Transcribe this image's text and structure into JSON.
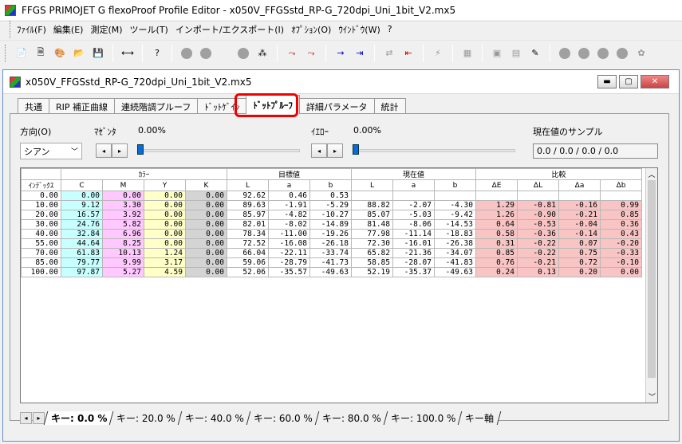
{
  "app": {
    "title": "FFGS PRIMOJET G flexoProof Profile Editor - x050V_FFGSstd_RP-G_720dpi_Uni_1bit_V2.mx5"
  },
  "menu": [
    "ﾌｧｲﾙ(F)",
    "編集(E)",
    "測定(M)",
    "ツール(T)",
    "インポート/エクスポート(I)",
    "ｵﾌﾟｼｮﾝ(O)",
    "ｳｲﾝﾄﾞｳ(W)",
    "?"
  ],
  "child": {
    "title": "x050V_FFGSstd_RP-G_720dpi_Uni_1bit_V2.mx5"
  },
  "tabs": [
    "共通",
    "RIP 補正曲線",
    "連続階調プルーフ",
    "ﾄﾞｯﾄｹﾞｲﾝ",
    "ﾄﾞｯﾄﾌﾟﾙｰﾌ",
    "詳細パラメータ",
    "統計"
  ],
  "active_tab": 4,
  "controls": {
    "direction_label": "方向(O)",
    "direction_value": "シアン",
    "magenta_label": "ﾏｾﾞﾝﾀ",
    "magenta_value": "0.00%",
    "yellow_label": "ｲｴﾛｰ",
    "yellow_value": "0.00%",
    "sample_label": "現在値のサンプル",
    "sample_value": "0.0 / 0.0 / 0.0 / 0.0"
  },
  "table": {
    "groups": {
      "color": "ｶﾗｰ",
      "target": "目標値",
      "current": "現在値",
      "compare": "比較"
    },
    "headers": [
      "ｲﾝﾃﾞｯｸｽ",
      "C",
      "M",
      "Y",
      "K",
      "L",
      "a",
      "b",
      "L",
      "a",
      "b",
      "ΔE",
      "ΔL",
      "Δa",
      "Δb"
    ],
    "rows": [
      [
        "0.00",
        "0.00",
        "0.00",
        "0.00",
        "0.00",
        "92.62",
        "0.46",
        "0.53",
        "",
        "",
        "",
        "",
        "",
        "",
        ""
      ],
      [
        "10.00",
        "9.12",
        "3.30",
        "0.00",
        "0.00",
        "89.63",
        "-1.91",
        "-5.29",
        "88.82",
        "-2.07",
        "-4.30",
        "1.29",
        "-0.81",
        "-0.16",
        "0.99"
      ],
      [
        "20.00",
        "16.57",
        "3.92",
        "0.00",
        "0.00",
        "85.97",
        "-4.82",
        "-10.27",
        "85.07",
        "-5.03",
        "-9.42",
        "1.26",
        "-0.90",
        "-0.21",
        "0.85"
      ],
      [
        "30.00",
        "24.76",
        "5.82",
        "0.00",
        "0.00",
        "82.01",
        "-8.02",
        "-14.89",
        "81.48",
        "-8.06",
        "-14.53",
        "0.64",
        "-0.53",
        "-0.04",
        "0.36"
      ],
      [
        "40.00",
        "32.84",
        "6.96",
        "0.00",
        "0.00",
        "78.34",
        "-11.00",
        "-19.26",
        "77.98",
        "-11.14",
        "-18.83",
        "0.58",
        "-0.36",
        "-0.14",
        "0.43"
      ],
      [
        "55.00",
        "44.64",
        "8.25",
        "0.00",
        "0.00",
        "72.52",
        "-16.08",
        "-26.18",
        "72.30",
        "-16.01",
        "-26.38",
        "0.31",
        "-0.22",
        "0.07",
        "-0.20"
      ],
      [
        "70.00",
        "61.83",
        "10.13",
        "1.24",
        "0.00",
        "66.04",
        "-22.11",
        "-33.74",
        "65.82",
        "-21.36",
        "-34.07",
        "0.85",
        "-0.22",
        "0.75",
        "-0.33"
      ],
      [
        "85.00",
        "79.77",
        "9.99",
        "3.17",
        "0.00",
        "59.06",
        "-28.79",
        "-41.73",
        "58.85",
        "-28.07",
        "-41.83",
        "0.76",
        "-0.21",
        "0.72",
        "-0.10"
      ],
      [
        "100.00",
        "97.87",
        "5.27",
        "4.59",
        "0.00",
        "52.06",
        "-35.57",
        "-49.63",
        "52.19",
        "-35.37",
        "-49.63",
        "0.24",
        "0.13",
        "0.20",
        "0.00"
      ]
    ]
  },
  "sheets": [
    "キー: 0.0 %",
    "キー: 20.0 %",
    "キー: 40.0 %",
    "キー: 60.0 %",
    "キー: 80.0 %",
    "キー: 100.0 %",
    "キー軸"
  ],
  "active_sheet": 0,
  "colors": {
    "cyan": "#c8ffff",
    "magenta": "#ffc8ff",
    "yellow": "#ffffc8",
    "black": "#d4d4d4",
    "delta": "#f8c4c4"
  }
}
